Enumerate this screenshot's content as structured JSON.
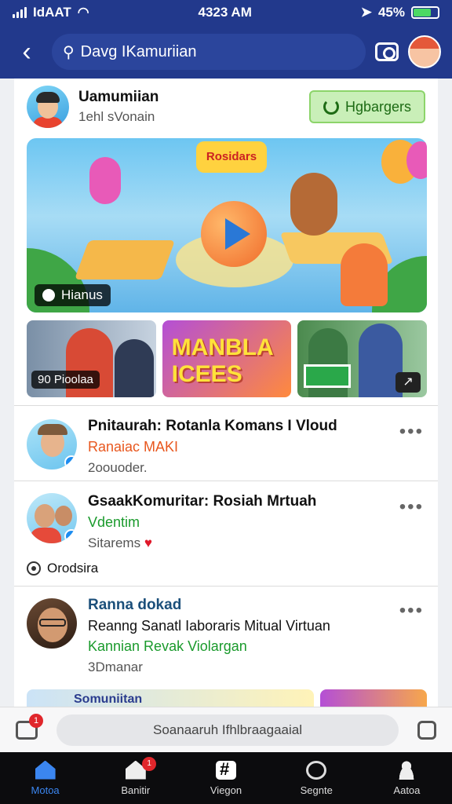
{
  "status": {
    "carrier": "IdAAT",
    "time": "4323 AM",
    "battery": "45%"
  },
  "header": {
    "search_text": "Davg IKamuriian"
  },
  "profile": {
    "name": "Uamumiian",
    "subtitle": "1ehl sVonain",
    "follow_label": "Hgbargers"
  },
  "hero": {
    "logo_text": "Rosidars",
    "tag_label": "Hianus"
  },
  "thumbs": [
    {
      "caption": "90 Pioolaa"
    },
    {
      "caption": "MANBLA ICEES"
    },
    {
      "caption": ""
    }
  ],
  "posts": [
    {
      "title": "Pnitaurah: Rotanla Komans I Vloud",
      "line2": "Ranaiac MAKI",
      "meta": "2oouoder.",
      "more": "•••"
    },
    {
      "title": "GsaakKomuritar: Rosiah Mrtuah",
      "line2": "Vdentim",
      "meta": "Sitarems",
      "more": "•••"
    },
    {
      "title": "Ranna dokad",
      "line2": "Reanng Sanatl Iaboraris Mitual Virtuan",
      "line3": "Kannian Revak Violargan",
      "meta": "3Dmanar",
      "more": "•••"
    }
  ],
  "stat_label": "Orodsira",
  "peek_label": "Somuniitan",
  "comment_bar": {
    "placeholder": "Soanaaruh Ifhlbraagaaial",
    "badge": "1"
  },
  "tabs": [
    {
      "label": "Motoa",
      "active": true
    },
    {
      "label": "Banitir",
      "badge": "1"
    },
    {
      "label": "Viegon"
    },
    {
      "label": "Segnte"
    },
    {
      "label": "Aatoa"
    }
  ]
}
